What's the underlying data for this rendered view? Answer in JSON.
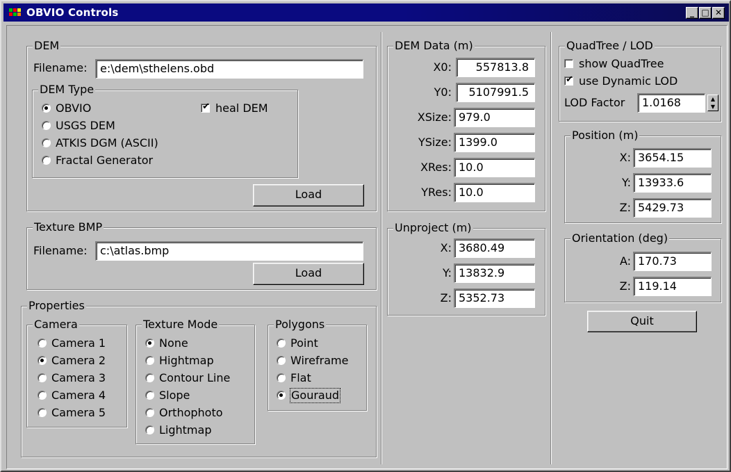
{
  "window": {
    "title": "OBVIO Controls",
    "controls": {
      "minimize": "_",
      "maximize": "□",
      "close": "✕"
    }
  },
  "dem": {
    "legend": "DEM",
    "filename_label": "Filename:",
    "filename_value": "e:\\dem\\sthelens.obd",
    "type_legend": "DEM Type",
    "types": [
      "OBVIO",
      "USGS DEM",
      "ATKIS DGM (ASCII)",
      "Fractal Generator"
    ],
    "selected_type": "OBVIO",
    "heal_label": "heal DEM",
    "heal_checked": true,
    "load_label": "Load"
  },
  "texture": {
    "legend": "Texture BMP",
    "filename_label": "Filename:",
    "filename_value": "c:\\atlas.bmp",
    "load_label": "Load"
  },
  "properties": {
    "legend": "Properties",
    "camera": {
      "legend": "Camera",
      "options": [
        "Camera 1",
        "Camera 2",
        "Camera 3",
        "Camera 4",
        "Camera 5"
      ],
      "selected": "Camera 2"
    },
    "texture_mode": {
      "legend": "Texture Mode",
      "options": [
        "None",
        "Hightmap",
        "Contour Line",
        "Slope",
        "Orthophoto",
        "Lightmap"
      ],
      "selected": "None"
    },
    "polygons": {
      "legend": "Polygons",
      "options": [
        "Point",
        "Wireframe",
        "Flat",
        "Gouraud"
      ],
      "selected": "Gouraud"
    }
  },
  "dem_data": {
    "legend": "DEM Data (m)",
    "x0_label": "X0:",
    "x0": "557813.8",
    "y0_label": "Y0:",
    "y0": "5107991.5",
    "xsize_label": "XSize:",
    "xsize": "979.0",
    "ysize_label": "YSize:",
    "ysize": "1399.0",
    "xres_label": "XRes:",
    "xres": "10.0",
    "yres_label": "YRes:",
    "yres": "10.0"
  },
  "unproject": {
    "legend": "Unproject (m)",
    "x_label": "X:",
    "x": "3680.49",
    "y_label": "Y:",
    "y": "13832.9",
    "z_label": "Z:",
    "z": "5352.73"
  },
  "quadtree": {
    "legend": "QuadTree / LOD",
    "show_label": "show QuadTree",
    "show_checked": false,
    "dynamic_label": "use Dynamic LOD",
    "dynamic_checked": true,
    "lod_label": "LOD Factor",
    "lod_value": "1.0168"
  },
  "position": {
    "legend": "Position (m)",
    "x_label": "X:",
    "x": "3654.15",
    "y_label": "Y:",
    "y": "13933.6",
    "z_label": "Z:",
    "z": "5429.73"
  },
  "orientation": {
    "legend": "Orientation (deg)",
    "a_label": "A:",
    "a": "170.73",
    "z_label": "Z:",
    "z": "119.14"
  },
  "quit_label": "Quit"
}
